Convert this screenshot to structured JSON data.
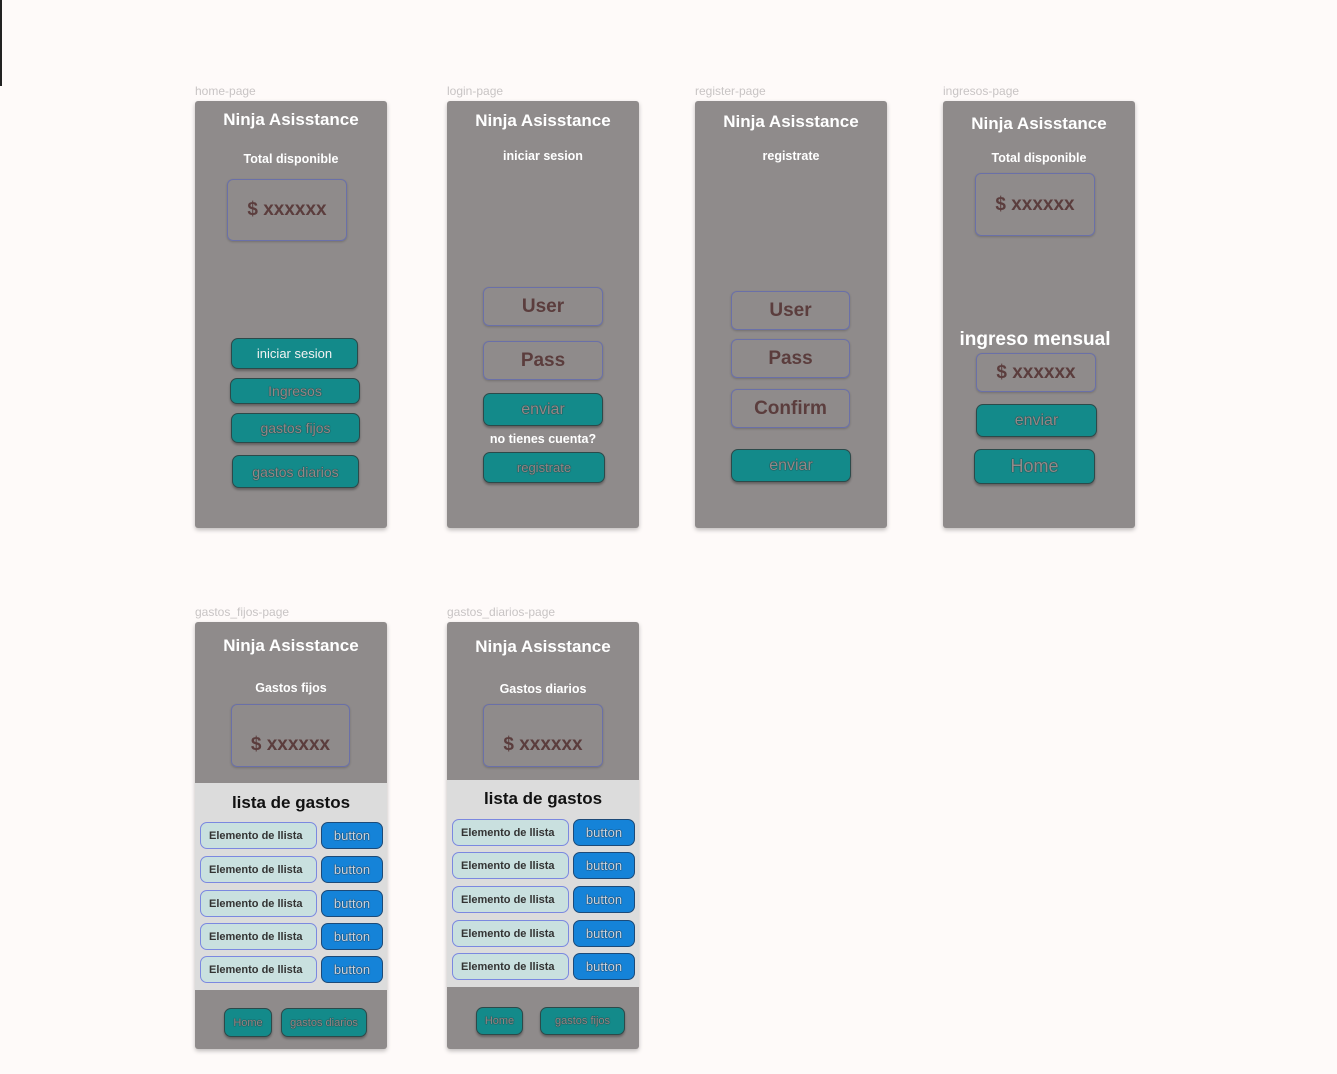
{
  "app_title": "Ninja Asisstance",
  "amount": "$ xxxxxx",
  "frames": {
    "home": {
      "label": "home-page",
      "subtitle": "Total disponible",
      "buttons": [
        "iniciar sesion",
        "Ingresos",
        "gastos fijos",
        "gastos diarios"
      ]
    },
    "login": {
      "label": "login-page",
      "subtitle": "iniciar sesion",
      "user": "User",
      "pass": "Pass",
      "send": "enviar",
      "no_account": "no tienes cuenta?",
      "register": "registrate"
    },
    "register": {
      "label": "register-page",
      "subtitle": "registrate",
      "user": "User",
      "pass": "Pass",
      "confirm": "Confirm",
      "send": "enviar"
    },
    "ingresos": {
      "label": "ingresos-page",
      "subtitle": "Total disponible",
      "monthly_label": "ingreso mensual",
      "send": "enviar",
      "home": "Home"
    },
    "gastos_fijos": {
      "label": "gastos_fijos-page",
      "subtitle": "Gastos fijos",
      "list_title": "lista de gastos",
      "item": "Elemento de llista",
      "item_button": "button",
      "home": "Home",
      "other": "gastos diarios"
    },
    "gastos_diarios": {
      "label": "gastos_diarios-page",
      "subtitle": "Gastos diarios",
      "list_title": "lista de gastos",
      "item": "Elemento de llista",
      "item_button": "button",
      "home": "Home",
      "other": "gastos fijos"
    }
  },
  "colors": {
    "frame": "#8f8b8b",
    "teal_button": "#138a8a",
    "blue_button": "#1583d8",
    "list_item": "#c9e0df"
  }
}
